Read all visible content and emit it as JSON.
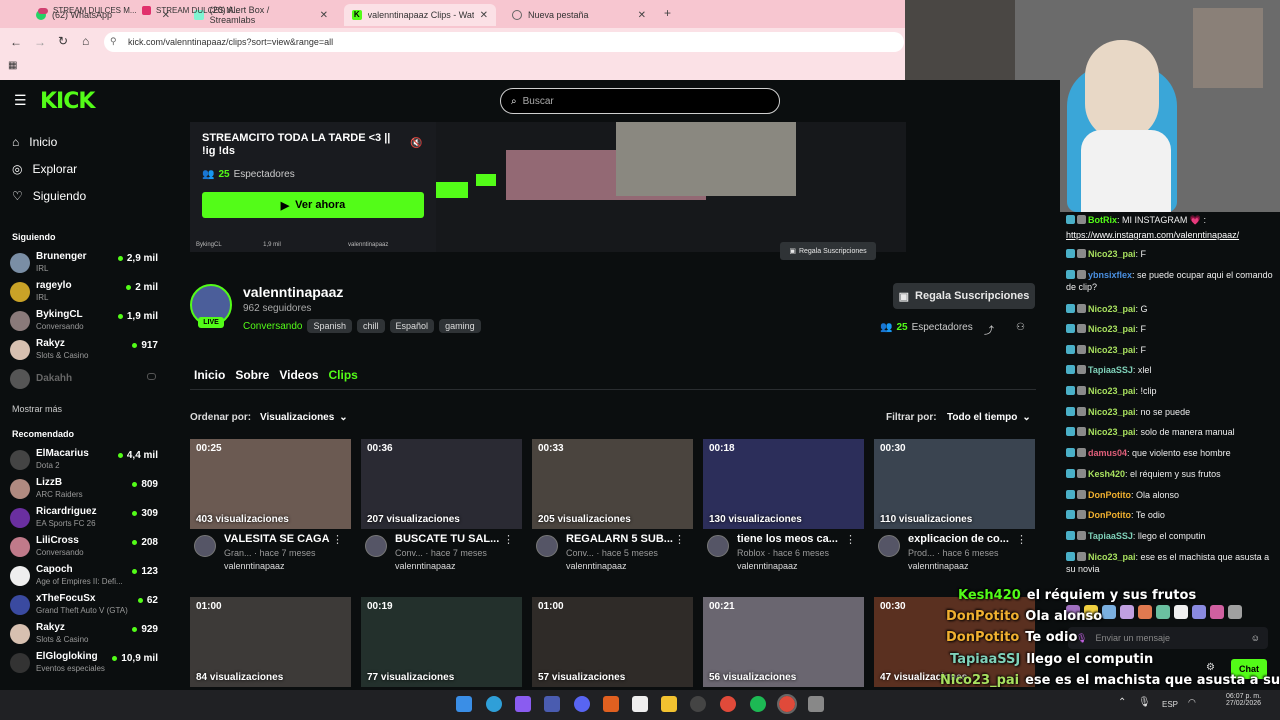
{
  "browser": {
    "tabs": [
      {
        "label": "(62) WhatsApp",
        "color": "#25d366"
      },
      {
        "label": "(20) Alert Box / Streamlabs",
        "color": "#80f5d2"
      },
      {
        "label": "valenntinapaaz Clips - Watch L",
        "color": "#53fc18"
      },
      {
        "label": "Nueva pestaña",
        "color": "#888888"
      }
    ],
    "url": "kick.com/valenntinapaaz/clips?sort=view&range=all",
    "bookmarks": [
      "STREAM DULCES M...",
      "STREAM DULCES M..."
    ]
  },
  "header": {
    "logo": "KICK",
    "search_placeholder": "Buscar"
  },
  "sidebar": {
    "nav": [
      "Inicio",
      "Explorar",
      "Siguiendo"
    ],
    "following_title": "Siguiendo",
    "following": [
      {
        "name": "Brunenger",
        "game": "IRL",
        "viewers": "2,9 mil",
        "color": "#7a8ea5"
      },
      {
        "name": "rageylo",
        "game": "IRL",
        "viewers": "2 mil",
        "color": "#c9a227"
      },
      {
        "name": "BykingCL",
        "game": "Conversando",
        "viewers": "1,9 mil",
        "color": "#8a7a7a"
      },
      {
        "name": "Rakyz",
        "game": "Slots & Casino",
        "viewers": "917",
        "color": "#d7c0b0"
      },
      {
        "name": "Dakahh",
        "game": "",
        "viewers": "",
        "color": "#555555"
      }
    ],
    "show_more": "Mostrar más",
    "recommended_title": "Recomendado",
    "recommended": [
      {
        "name": "ElMacarius",
        "game": "Dota 2",
        "viewers": "4,4 mil",
        "color": "#444"
      },
      {
        "name": "LizzB",
        "game": "ARC Raiders",
        "viewers": "809",
        "color": "#b08a80"
      },
      {
        "name": "Ricardriguez",
        "game": "EA Sports FC 26",
        "viewers": "309",
        "color": "#6a2fa0"
      },
      {
        "name": "LiliCross",
        "game": "Conversando",
        "viewers": "208",
        "color": "#c07a8a"
      },
      {
        "name": "Capoch",
        "game": "Age of Empires II: Defi...",
        "viewers": "123",
        "color": "#eeeeee"
      },
      {
        "name": "xTheFocuSx",
        "game": "Grand Theft Auto V (GTA)",
        "viewers": "62",
        "color": "#3a4aa0"
      },
      {
        "name": "Rakyz",
        "game": "Slots & Casino",
        "viewers": "929",
        "color": "#d7c0b0"
      },
      {
        "name": "ElGlogloking",
        "game": "Eventos especiales",
        "viewers": "10,9 mil",
        "color": "#333"
      }
    ]
  },
  "preview": {
    "title": "STREAMCITO TODA LA TARDE <3 ||",
    "title2": "!ig !ds",
    "viewers": "25",
    "viewers_label": "Espectadores",
    "watch_button": "Ver ahora",
    "overlay_sub_button": "Regala Suscripciones",
    "mini_channel": "valenntinapaaz",
    "mini_followers": "962 seguidores",
    "mini_left": "BykingCL",
    "mini_left_viewers": "1,9 mil",
    "mini_chat_search": "Buscar"
  },
  "channel": {
    "name": "valenntinapaaz",
    "followers": "962 seguidores",
    "live_badge": "LIVE",
    "category": "Conversando",
    "tags": [
      "Spanish",
      "chill",
      "Español",
      "gaming"
    ],
    "sub_button": "Regala Suscripciones",
    "viewers": "25",
    "viewers_label": "Espectadores"
  },
  "tabs": [
    "Inicio",
    "Sobre",
    "Videos",
    "Clips"
  ],
  "sort": {
    "label": "Ordenar por:",
    "value": "Visualizaciones"
  },
  "filter": {
    "label": "Filtrar por:",
    "value": "Todo el tiempo"
  },
  "clips": [
    {
      "duration": "00:25",
      "views": "403 visualizaciones",
      "title": "VALESITA SE CAGA",
      "meta": "Gran... · hace 7 meses",
      "user": "valenntinapaaz",
      "color": "#6b5a52"
    },
    {
      "duration": "00:36",
      "views": "207 visualizaciones",
      "title": "BUSCATE TU SAL...",
      "meta": "Conv... · hace 7 meses",
      "user": "valenntinapaaz",
      "color": "#2a2a33"
    },
    {
      "duration": "00:33",
      "views": "205 visualizaciones",
      "title": "REGALARN 5 SUB...",
      "meta": "Conv... · hace 5 meses",
      "user": "valenntinapaaz",
      "color": "#4a443e"
    },
    {
      "duration": "00:18",
      "views": "130 visualizaciones",
      "title": "tiene los meos ca...",
      "meta": "Roblox · hace 6 meses",
      "user": "valenntinapaaz",
      "color": "#2c2e5a"
    },
    {
      "duration": "00:30",
      "views": "110 visualizaciones",
      "title": "explicacion de co...",
      "meta": "Prod... · hace 6 meses",
      "user": "valenntinapaaz",
      "color": "#3a4450"
    },
    {
      "duration": "01:00",
      "views": "84 visualizaciones",
      "title": "",
      "meta": "",
      "user": "",
      "color": "#3d3a38"
    },
    {
      "duration": "00:19",
      "views": "77 visualizaciones",
      "title": "",
      "meta": "",
      "user": "",
      "color": "#23302c"
    },
    {
      "duration": "01:00",
      "views": "57 visualizaciones",
      "title": "",
      "meta": "",
      "user": "",
      "color": "#2f2b28"
    },
    {
      "duration": "00:21",
      "views": "56 visualizaciones",
      "title": "",
      "meta": "",
      "user": "",
      "color": "#6a6670"
    },
    {
      "duration": "00:30",
      "views": "47 visualizaciones",
      "title": "",
      "meta": "",
      "user": "",
      "color": "#5a3020"
    }
  ],
  "chat": {
    "messages": [
      {
        "user": "BotRix",
        "text": ": MI INSTAGRAM 💗 :",
        "color": "#53fc18"
      },
      {
        "user": "",
        "text": "https://www.instagram.com/valenntinapaaz/",
        "color": "#ffffff"
      },
      {
        "user": "Nico23_pai",
        "text": ": F",
        "color": "#a8e05f"
      },
      {
        "user": "ybnsixflex",
        "text": ": se puede ocupar aqui el comando de clip?",
        "color": "#4a90e2"
      },
      {
        "user": "Nico23_pai",
        "text": ": G",
        "color": "#a8e05f"
      },
      {
        "user": "Nico23_pai",
        "text": ": F",
        "color": "#a8e05f"
      },
      {
        "user": "Nico23_pai",
        "text": ": F",
        "color": "#a8e05f"
      },
      {
        "user": "TapiaaSSJ",
        "text": ": xlel",
        "color": "#7fd1b9"
      },
      {
        "user": "Nico23_pai",
        "text": ": !clip",
        "color": "#a8e05f"
      },
      {
        "user": "Nico23_pai",
        "text": ": no se puede",
        "color": "#a8e05f"
      },
      {
        "user": "Nico23_pai",
        "text": ": solo de manera manual",
        "color": "#a8e05f"
      },
      {
        "user": "damus04",
        "text": ": que violento ese hombre",
        "color": "#e05f7a"
      },
      {
        "user": "Kesh420",
        "text": ": el réquiem y sus frutos",
        "color": "#a8e05f"
      },
      {
        "user": "DonPotito",
        "text": ": Ola alonso",
        "color": "#f0b030"
      },
      {
        "user": "DonPotito",
        "text": ": Te odio",
        "color": "#f0b030"
      },
      {
        "user": "TapiaaSSJ",
        "text": ": llego el computin",
        "color": "#7fd1b9"
      },
      {
        "user": "Nico23_pai",
        "text": ": ese es el machista que asusta a su novia",
        "color": "#a8e05f"
      }
    ],
    "input_placeholder": "Enviar un mensaje",
    "send_button": "Chat"
  },
  "overlay": [
    {
      "user": "Kesh420",
      "text": "el réquiem y sus frutos",
      "color": "#53fc18"
    },
    {
      "user": "DonPotito",
      "text": "Ola alonso",
      "color": "#f0b030"
    },
    {
      "user": "DonPotito",
      "text": "Te odio",
      "color": "#f0b030"
    },
    {
      "user": "TapiaaSSJ",
      "text": "llego el computin",
      "color": "#7fd1b9"
    },
    {
      "user": "Nico23_pai",
      "text": "ese es el machista que asusta a su",
      "color": "#a8e05f"
    },
    {
      "user": "",
      "text": "novia",
      "color": "#ffffff"
    }
  ],
  "taskbar": {
    "lang": "ESP",
    "time": "06:07 p. m.",
    "date": "27/02/2026"
  }
}
